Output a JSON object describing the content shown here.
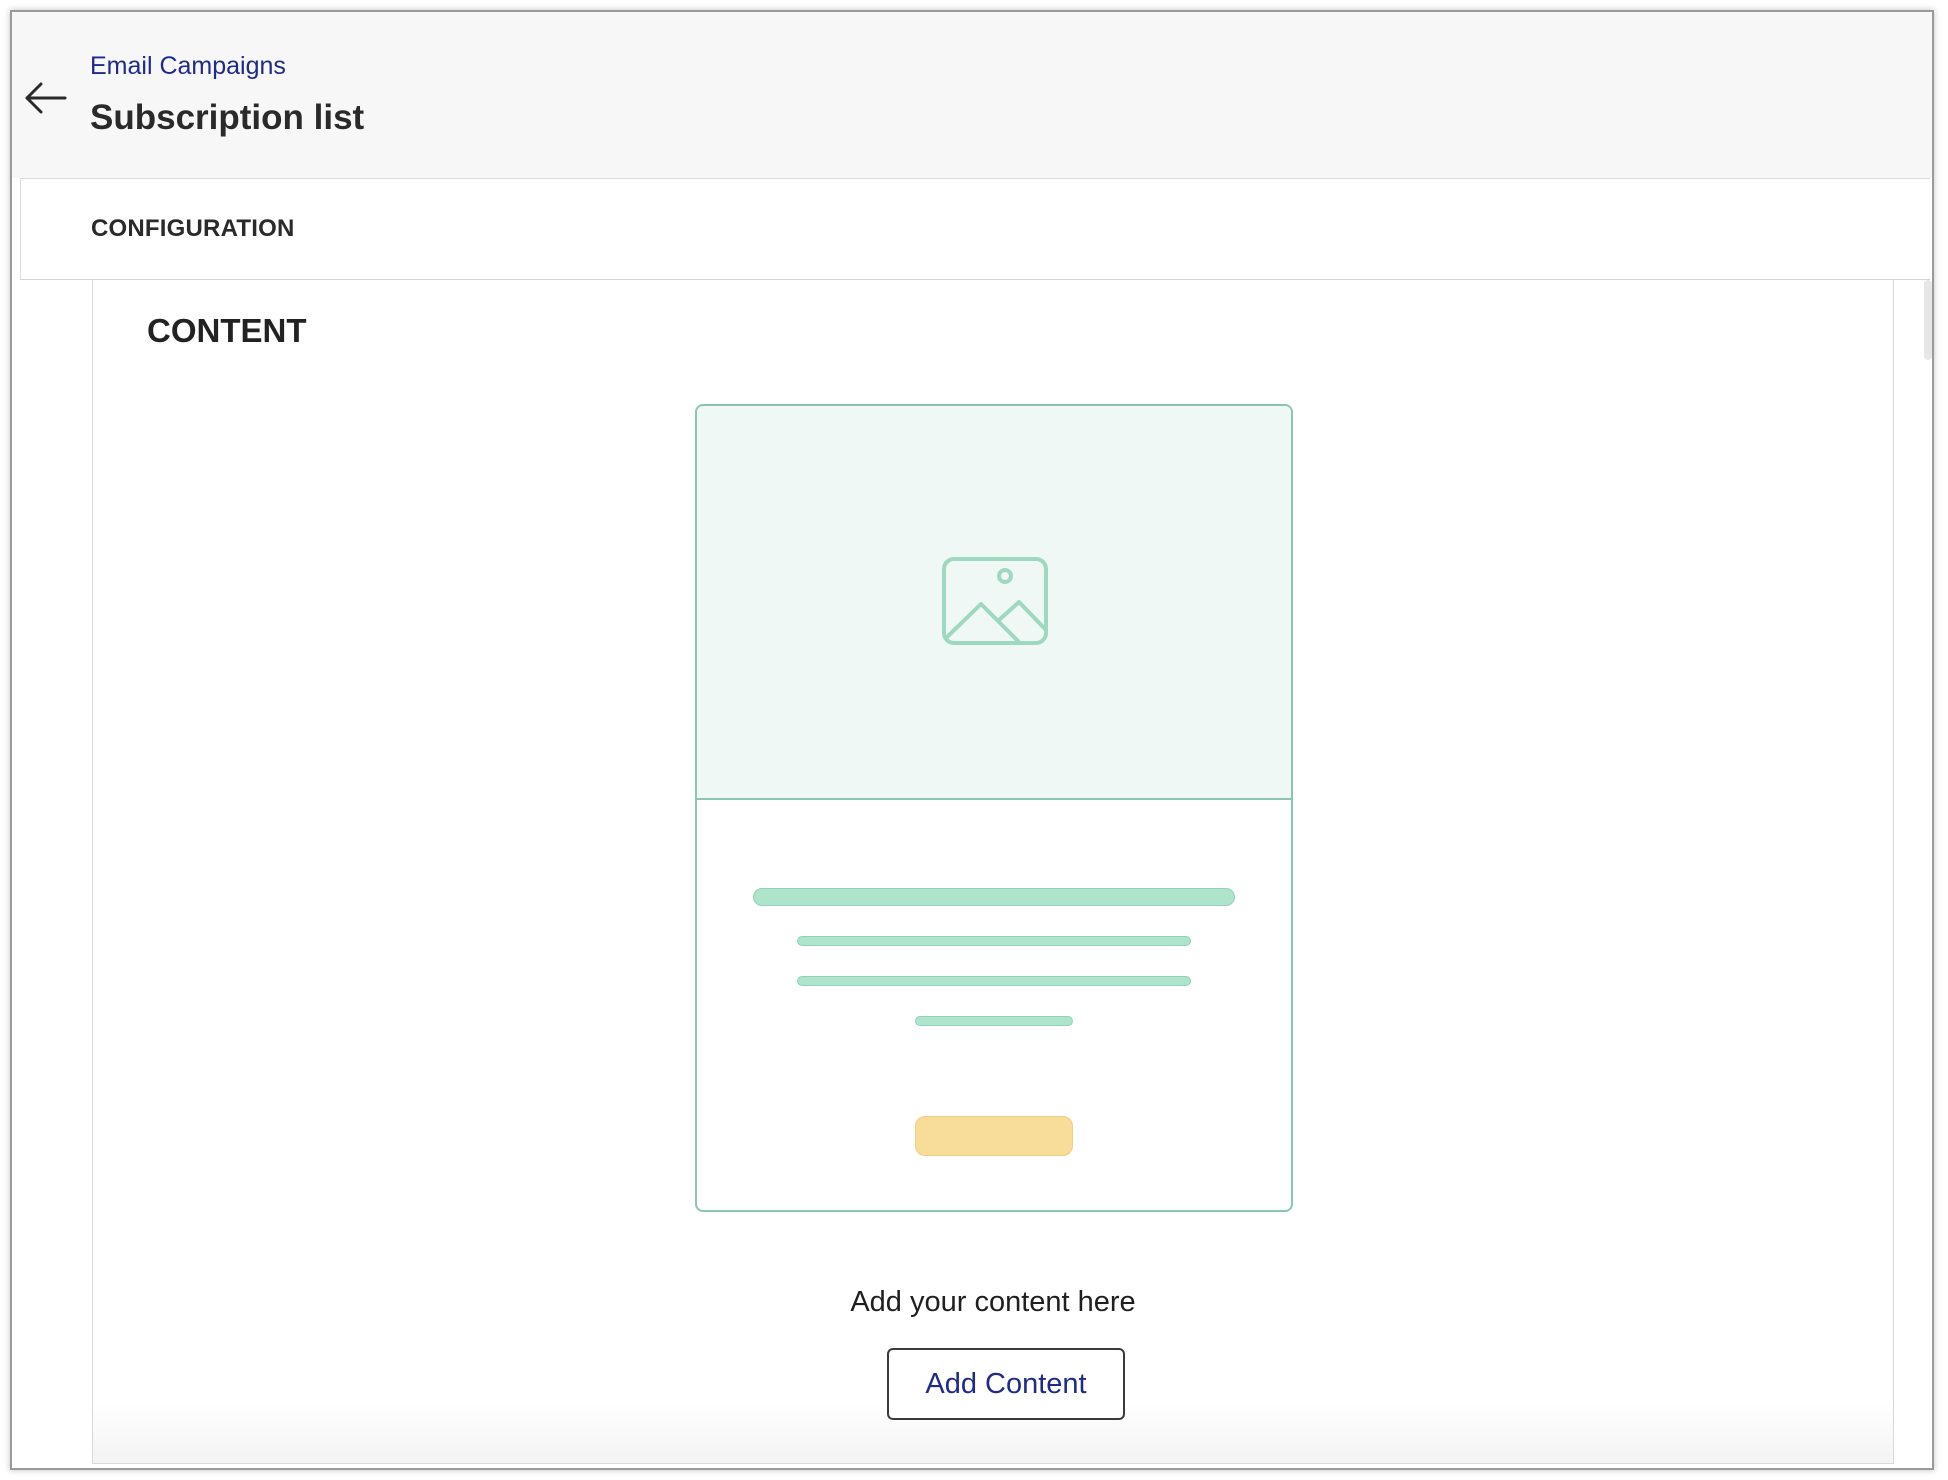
{
  "header": {
    "back_icon": "arrow-left-icon",
    "breadcrumb": "Email Campaigns",
    "title": "Subscription list"
  },
  "tabs": [
    {
      "label": "CONFIGURATION"
    }
  ],
  "content": {
    "section_title": "CONTENT",
    "placeholder_icon": "image-icon",
    "hint": "Add your content here",
    "add_button_label": "Add Content"
  },
  "colors": {
    "accent_link": "#1f2a8a",
    "card_border": "#8cc5b0",
    "card_image_bg": "#eff8f4",
    "placeholder_line": "#aee3cc",
    "placeholder_button": "#f8dd9a"
  }
}
